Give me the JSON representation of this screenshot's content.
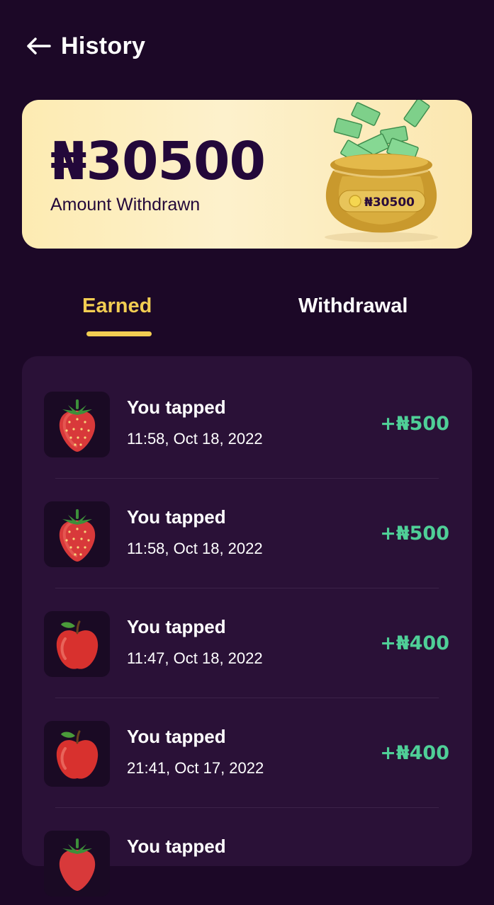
{
  "header": {
    "title": "History"
  },
  "banner": {
    "amount": "₦30500",
    "label": "Amount Withdrawn",
    "pot_badge": "₦30500"
  },
  "tabs": [
    {
      "label": "Earned",
      "active": true
    },
    {
      "label": "Withdrawal",
      "active": false
    }
  ],
  "transactions": [
    {
      "title": "You tapped",
      "date": "11:58, Oct 18, 2022",
      "amount": "+₦500",
      "icon": "strawberry-icon"
    },
    {
      "title": "You tapped",
      "date": "11:58, Oct 18, 2022",
      "amount": "+₦500",
      "icon": "strawberry-icon"
    },
    {
      "title": "You tapped",
      "date": "11:47, Oct 18, 2022",
      "amount": "+₦400",
      "icon": "apple-icon"
    },
    {
      "title": "You tapped",
      "date": "21:41, Oct 17, 2022",
      "amount": "+₦400",
      "icon": "apple-icon"
    },
    {
      "title": "You tapped",
      "date": "",
      "amount": "",
      "icon": "strawberry-icon"
    }
  ],
  "colors": {
    "background": "#1c0827",
    "accent": "#f2cd52",
    "positive": "#4fcf97",
    "card": "#2a1137"
  }
}
